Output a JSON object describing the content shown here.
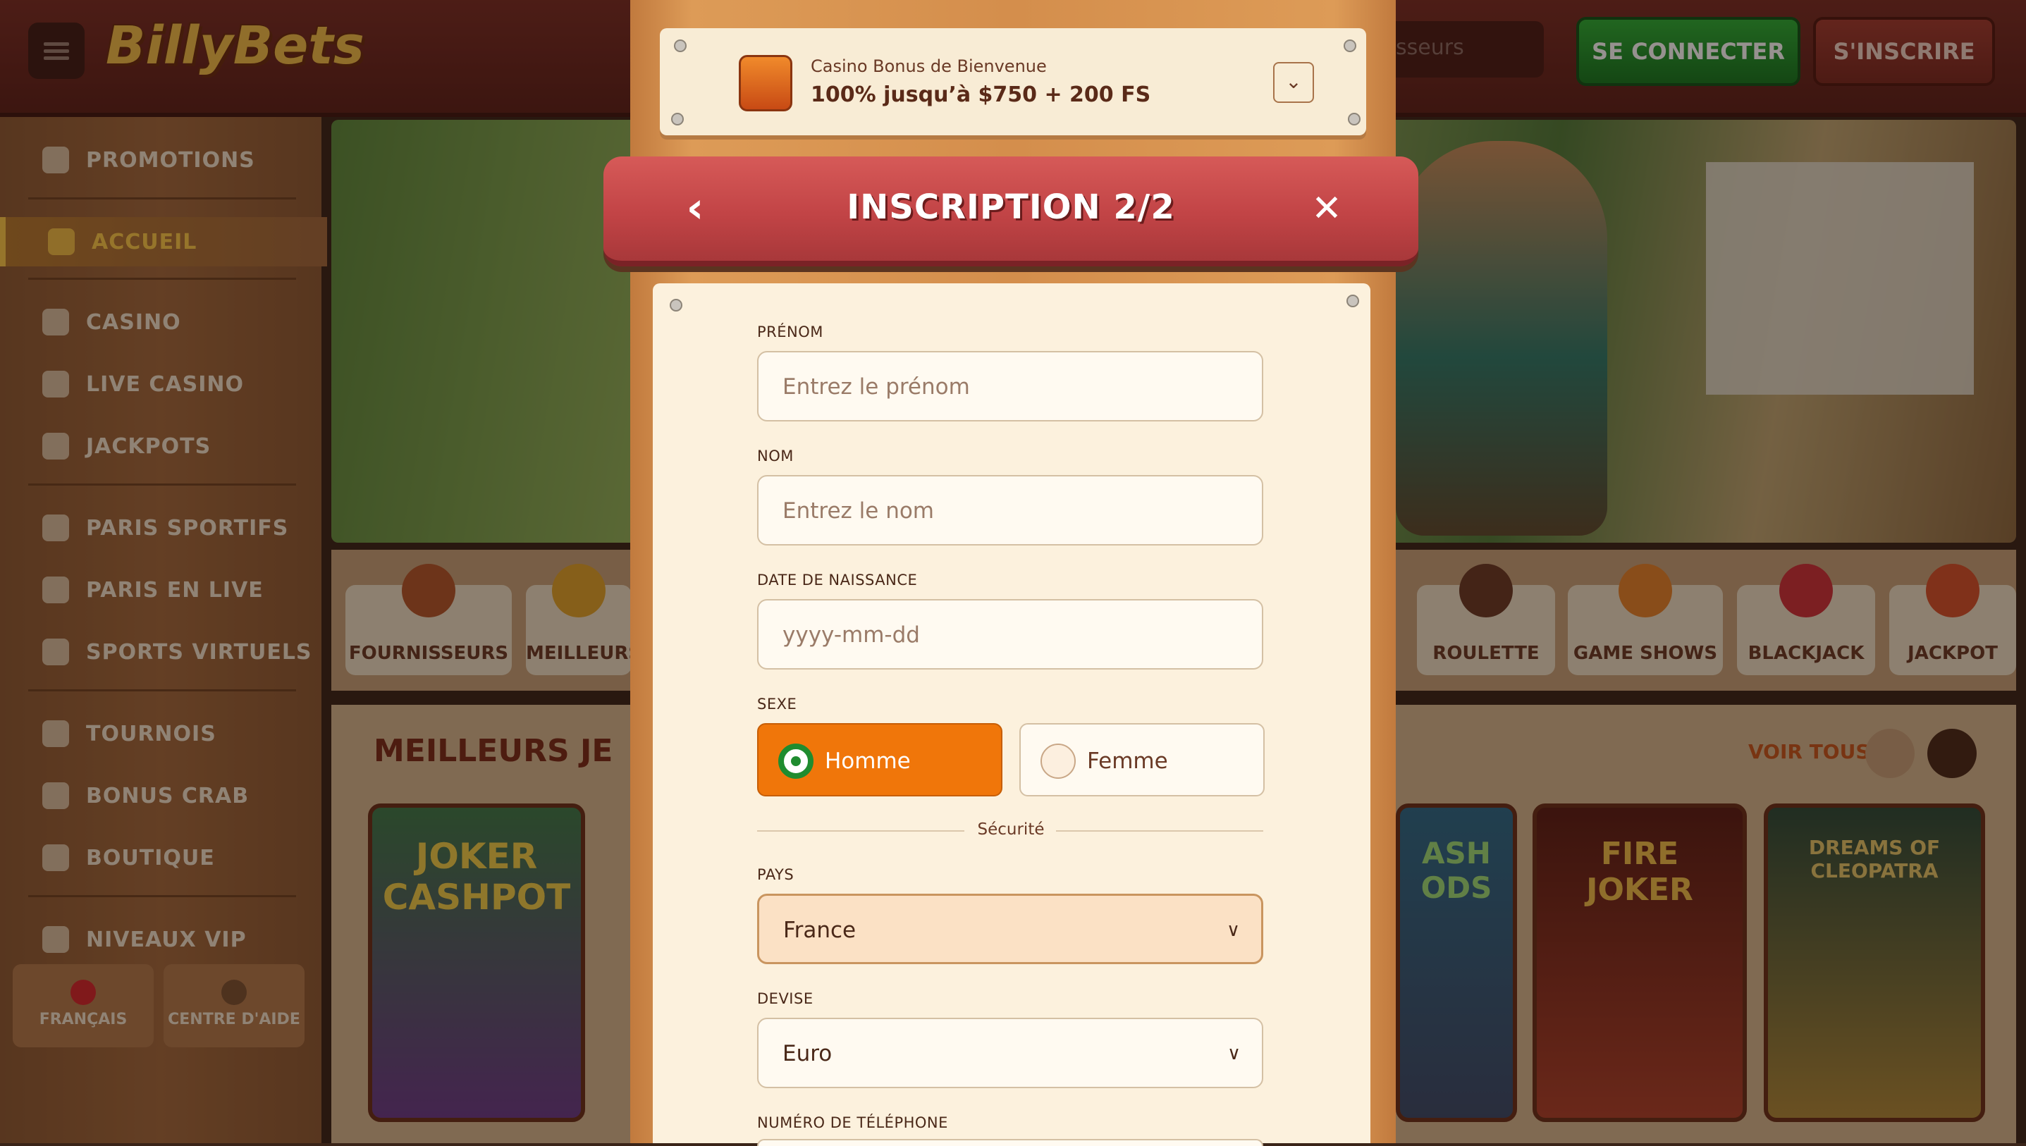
{
  "header": {
    "logo": "BillyBets",
    "search_placeholder": "sseurs",
    "login": "SE CONNECTER",
    "signup": "S'INSCRIRE"
  },
  "sidebar": {
    "items": [
      {
        "label": "PROMOTIONS",
        "icon": "gift-icon"
      },
      {
        "label": "ACCUEIL",
        "icon": "home-icon",
        "active": true
      },
      {
        "label": "CASINO",
        "icon": "slot-machine-icon"
      },
      {
        "label": "LIVE CASINO",
        "icon": "live-casino-icon"
      },
      {
        "label": "JACKPOTS",
        "icon": "clover-icon"
      },
      {
        "label": "PARIS SPORTIFS",
        "icon": "soccer-ball-icon"
      },
      {
        "label": "PARIS EN LIVE",
        "icon": "live-icon"
      },
      {
        "label": "SPORTS VIRTUELS",
        "icon": "virtual-sports-icon"
      },
      {
        "label": "TOURNOIS",
        "icon": "trophy-icon"
      },
      {
        "label": "BONUS CRAB",
        "icon": "crab-icon"
      },
      {
        "label": "BOUTIQUE",
        "icon": "shopping-bag-icon"
      },
      {
        "label": "NIVEAUX VIP",
        "icon": "diamond-icon"
      }
    ],
    "language": "FRANÇAIS",
    "help": "CENTRE D'AIDE"
  },
  "categories": [
    "FOURNISSEURS",
    "MEILLEURS",
    "ROULETTE",
    "GAME SHOWS",
    "BLACKJACK",
    "JACKPOT"
  ],
  "games_section": {
    "title": "MEILLEURS JE",
    "see_all": "VOIR TOUS",
    "games": [
      "JOKER CASHPOT",
      "ASH ODS",
      "FIRE JOKER",
      "DREAMS OF CLEOPATRA"
    ]
  },
  "modal": {
    "bonus_kicker": "Casino Bonus de Bienvenue",
    "bonus_amount": "100% jusqu’à $750 + 200 FS",
    "title": "INSCRIPTION 2/2",
    "fields": {
      "first_name_label": "PRÉNOM",
      "first_name_placeholder": "Entrez le prénom",
      "last_name_label": "NOM",
      "last_name_placeholder": "Entrez le nom",
      "dob_label": "DATE DE NAISSANCE",
      "dob_placeholder": "yyyy-mm-dd",
      "gender_label": "SEXE",
      "gender_male": "Homme",
      "gender_female": "Femme",
      "security_divider": "Sécurité",
      "country_label": "PAYS",
      "country_value": "France",
      "currency_label": "DEVISE",
      "currency_value": "Euro",
      "phone_label": "NUMÉRO DE TÉLÉPHONE"
    }
  },
  "colors": {
    "accent_orange": "#f0760a",
    "title_plank_red": "#c24446",
    "login_green": "#1f8c2f"
  }
}
